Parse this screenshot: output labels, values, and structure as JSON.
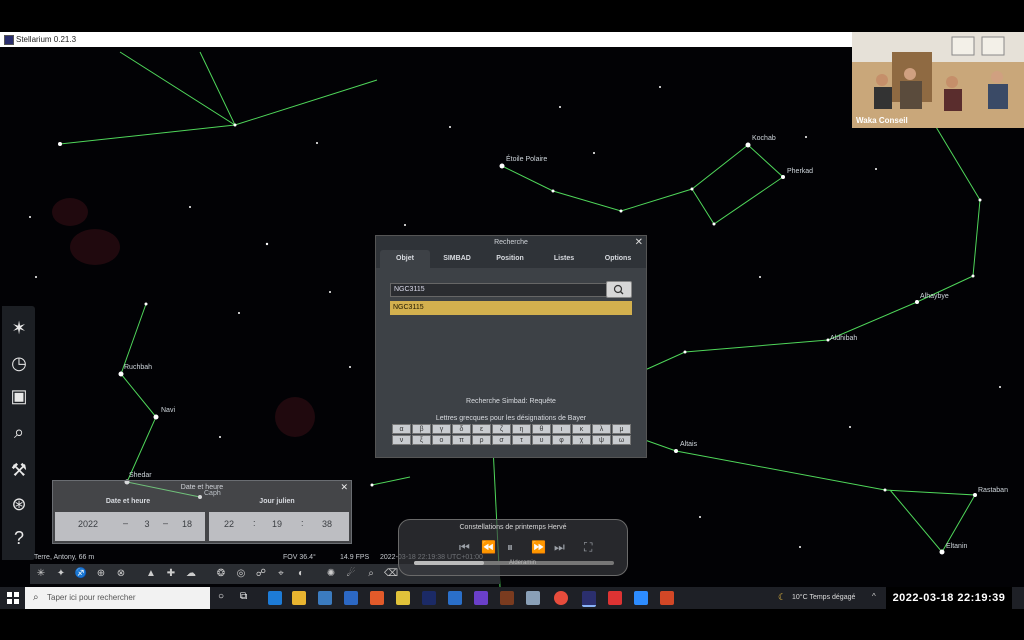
{
  "window": {
    "title": "Stellarium 0.21.3"
  },
  "webcam": {
    "name": "Waka Conseil"
  },
  "sky": {
    "labels": [
      "Étoile Polaire",
      "Kochab",
      "Pherkad",
      "Ruchbah",
      "Navi",
      "Shedar",
      "Caph",
      "Alhaybye",
      "Aldhibah",
      "Altais",
      "Rastaban",
      "Eltanin"
    ]
  },
  "left_toolbar": {
    "icons": [
      "star-burst-icon",
      "clock-icon",
      "sky-view-icon",
      "search-icon",
      "tools-icon",
      "compass-icon",
      "help-icon"
    ]
  },
  "search_dialog": {
    "title": "Recherche",
    "tabs": [
      "Objet",
      "SIMBAD",
      "Position",
      "Listes",
      "Options"
    ],
    "active_tab": "Objet",
    "input_value": "NGC3115",
    "result": "NGC3115",
    "simbad_status": "Recherche Simbad: Requête",
    "greek_label": "Lettres grecques pour les désignations de Bayer",
    "greek_row1": [
      "α",
      "β",
      "γ",
      "δ",
      "ε",
      "ζ",
      "η",
      "θ",
      "ι",
      "κ",
      "λ",
      "μ"
    ],
    "greek_row2": [
      "ν",
      "ξ",
      "ο",
      "π",
      "ρ",
      "σ",
      "τ",
      "υ",
      "φ",
      "χ",
      "ψ",
      "ω"
    ]
  },
  "date_panel": {
    "title": "Date et heure",
    "col_date": "Date et heure",
    "col_julian": "Jour julien",
    "year": "2022",
    "month": "3",
    "day": "18",
    "hour": "22",
    "minute": "19",
    "second": "38"
  },
  "status": {
    "location": "Terre, Antony, 66 m",
    "fov": "FOV 36.4°",
    "fps": "14.9 FPS",
    "datetime": "2022-03-18 22:19:38 UTC+01:00"
  },
  "playback": {
    "title": "Constellations de printemps Hervé",
    "progress": 0.35,
    "star_label": "Alderamin"
  },
  "taskbar": {
    "search_placeholder": "Taper ici pour rechercher",
    "weather": "10°C  Temps dégagé",
    "clock": "2022-03-18  22:19:39"
  }
}
